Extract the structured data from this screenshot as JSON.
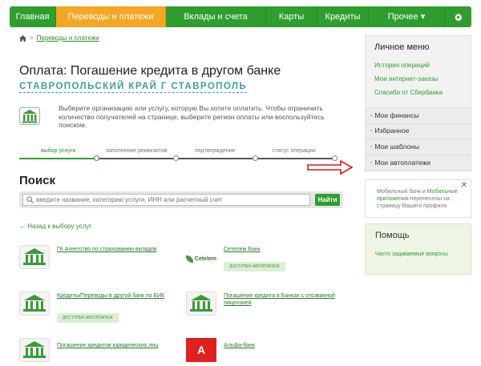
{
  "nav": {
    "items": [
      "Главная",
      "Переводы и платежи",
      "Вклады и счета",
      "Карты",
      "Кредиты",
      "Прочее"
    ],
    "more_chevron": "▾",
    "settings_icon": "gear-icon"
  },
  "breadcrumb": {
    "home_icon": "home-icon",
    "separator": ">",
    "link": "Переводы и платежи"
  },
  "page": {
    "title": "Оплата: Погашение кредита в другом банке",
    "region": "СТАВРОПОЛЬСКИЙ КРАЙ Г СТАВРОПОЛЬ",
    "info": "Выберите организацию или услугу, которую Вы хотите оплатить. Чтобы ограничить количество получателей на странице, выберите регион оплаты или воспользуйтесь поиском."
  },
  "steps": [
    "выбор услуги",
    "заполнение реквизитов",
    "подтверждение",
    "статус операции"
  ],
  "search": {
    "title": "Поиск",
    "placeholder": "введите название, категорию услуги, ИНН или расчетный счет",
    "button": "Найти"
  },
  "back_link": "Назад к выбору услуг",
  "orgs": [
    {
      "name": "ГК Агентство по страхованию вкладов",
      "badge": ""
    },
    {
      "name": "Сетелем Банк",
      "logo_text": "Cetelem",
      "badge": "ДОСТУПЕН АВТОПЛАТЕЖ"
    },
    {
      "name": "Кредиты/Переводы в другой банк по БИК",
      "badge": "ДОСТУПЕН АВТОПЛАТЕЖ"
    },
    {
      "name": "Погашение кредита в Банках с отозванной лицензией",
      "badge": ""
    },
    {
      "name": "Погашение кредитов юридических лиц",
      "badge": ""
    },
    {
      "name": "Альфа-банк",
      "logo_text": "A",
      "badge": ""
    }
  ],
  "sidebar": {
    "menu_title": "Личное меню",
    "links": [
      "История операций",
      "Мои интернет-заказы",
      "Спасибо от Сбербанка"
    ],
    "accordion": [
      "Мои финансы",
      "Избранное",
      "Мои шаблоны",
      "Мои автоплатежи"
    ],
    "notice": {
      "prefix": "Мобильный банк и ",
      "link": "Мобильные приложения",
      "suffix": " перенесены на страницу Вашего профиля"
    },
    "help_title": "Помощь",
    "help_link": "Часто задаваемые вопросы"
  },
  "colors": {
    "brand_green": "#2f9e2f",
    "active_orange": "#f5a623",
    "annotation_red": "#d91a1a"
  }
}
